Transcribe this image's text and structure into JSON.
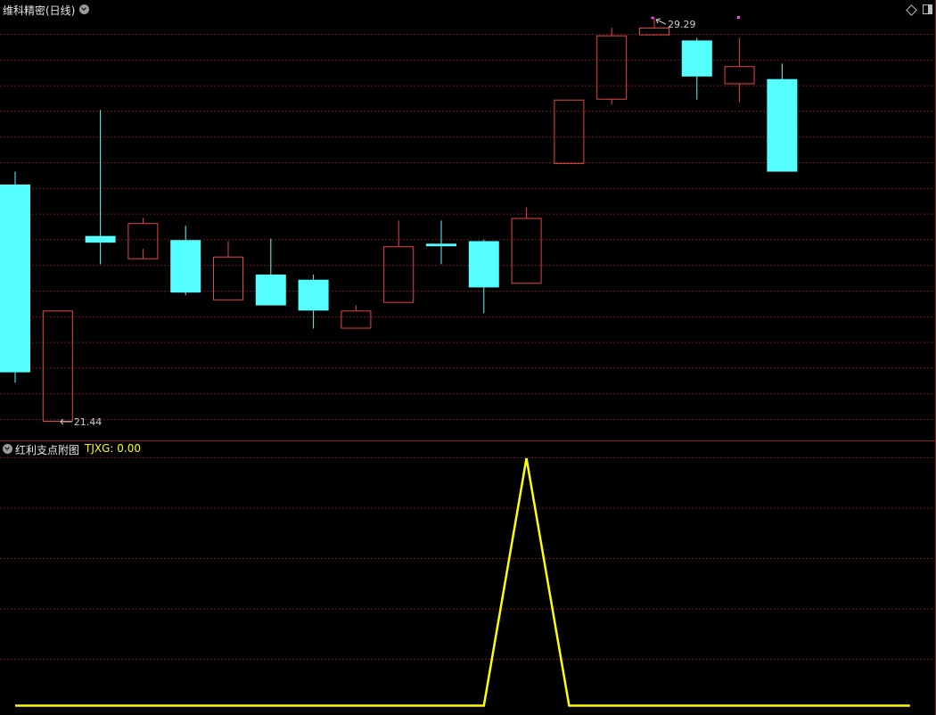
{
  "main_panel": {
    "title": "维科精密(日线)",
    "high_label": "29.29",
    "low_label": "21.44"
  },
  "indicator_panel": {
    "title": "红利支点附图",
    "value_label": "TJXG: 0.00"
  },
  "colors": {
    "up": "#e84444",
    "down": "#55ffff",
    "grid": "#6b1a1a",
    "line": "#ffff00",
    "separator": "#8a1f1f"
  },
  "chart_data": [
    {
      "type": "candlestick",
      "title": "维科精密(日线)",
      "ohlc": [
        {
          "open": 26.05,
          "high": 26.3,
          "low": 22.2,
          "close": 22.4
        },
        {
          "open": 21.44,
          "high": 23.6,
          "low": 21.44,
          "close": 23.6
        },
        {
          "open": 25.05,
          "high": 27.5,
          "low": 24.5,
          "close": 24.92
        },
        {
          "open": 24.6,
          "high": 25.4,
          "low": 24.8,
          "close": 25.3
        },
        {
          "open": 24.97,
          "high": 25.25,
          "low": 23.9,
          "close": 23.95
        },
        {
          "open": 23.8,
          "high": 24.95,
          "low": 23.8,
          "close": 24.65
        },
        {
          "open": 24.3,
          "high": 25.0,
          "low": 24.12,
          "close": 23.7
        },
        {
          "open": 24.2,
          "high": 24.3,
          "low": 23.25,
          "close": 23.6
        },
        {
          "open": 23.25,
          "high": 23.7,
          "low": 23.25,
          "close": 23.6
        },
        {
          "open": 23.75,
          "high": 25.35,
          "low": 23.75,
          "close": 24.85
        },
        {
          "open": 24.9,
          "high": 25.35,
          "low": 24.5,
          "close": 24.85
        },
        {
          "open": 24.95,
          "high": 24.98,
          "low": 23.55,
          "close": 24.05
        },
        {
          "open": 24.12,
          "high": 25.6,
          "low": 24.12,
          "close": 25.4
        },
        {
          "open": 26.45,
          "high": 27.7,
          "low": 26.45,
          "close": 27.7
        },
        {
          "open": 27.7,
          "high": 29.1,
          "low": 27.6,
          "close": 28.95
        },
        {
          "open": 28.95,
          "high": 29.29,
          "low": 28.95,
          "close": 29.1
        },
        {
          "open": 28.85,
          "high": 28.9,
          "low": 27.7,
          "close": 28.15
        },
        {
          "open": 28.0,
          "high": 28.9,
          "low": 27.65,
          "close": 28.35
        },
        {
          "open": 28.1,
          "high": 28.4,
          "low": 26.3,
          "close": 26.3
        }
      ],
      "high_label": "29.29",
      "low_label": "21.44"
    },
    {
      "type": "line",
      "title": "红利支点附图",
      "series": [
        {
          "name": "TJXG",
          "values": [
            0,
            0,
            0,
            0,
            0,
            0,
            0,
            0,
            0,
            0,
            0,
            0,
            1,
            0,
            0,
            0,
            0,
            0,
            0,
            0,
            0,
            0
          ]
        }
      ]
    }
  ]
}
